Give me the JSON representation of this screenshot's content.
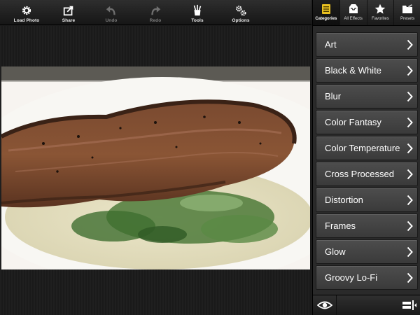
{
  "toolbar": {
    "buttons": [
      {
        "label": "Load Photo",
        "icon": "gear-icon",
        "enabled": true
      },
      {
        "label": "Share",
        "icon": "share-icon",
        "enabled": true
      },
      {
        "label": "Undo",
        "icon": "undo-icon",
        "enabled": false
      },
      {
        "label": "Redo",
        "icon": "redo-icon",
        "enabled": false
      },
      {
        "label": "Tools",
        "icon": "tools-icon",
        "enabled": true
      },
      {
        "label": "Options",
        "icon": "options-icon",
        "enabled": true
      }
    ]
  },
  "panel": {
    "tabs": [
      {
        "label": "Categories",
        "icon": "categories-icon",
        "active": true
      },
      {
        "label": "All Effects",
        "icon": "inbox-icon",
        "active": false
      },
      {
        "label": "Favorites",
        "icon": "star-icon",
        "active": false
      },
      {
        "label": "Presets",
        "icon": "folder-icon",
        "active": false
      }
    ],
    "categories": [
      "Art",
      "Black & White",
      "Blur",
      "Color Fantasy",
      "Color Temperature",
      "Cross Processed",
      "Distortion",
      "Frames",
      "Glow",
      "Groovy Lo-Fi"
    ]
  },
  "photo": {
    "subject": "steak-on-creamed-spinach"
  },
  "colors": {
    "accent": "#e8c021",
    "item_bg": "#444444"
  }
}
